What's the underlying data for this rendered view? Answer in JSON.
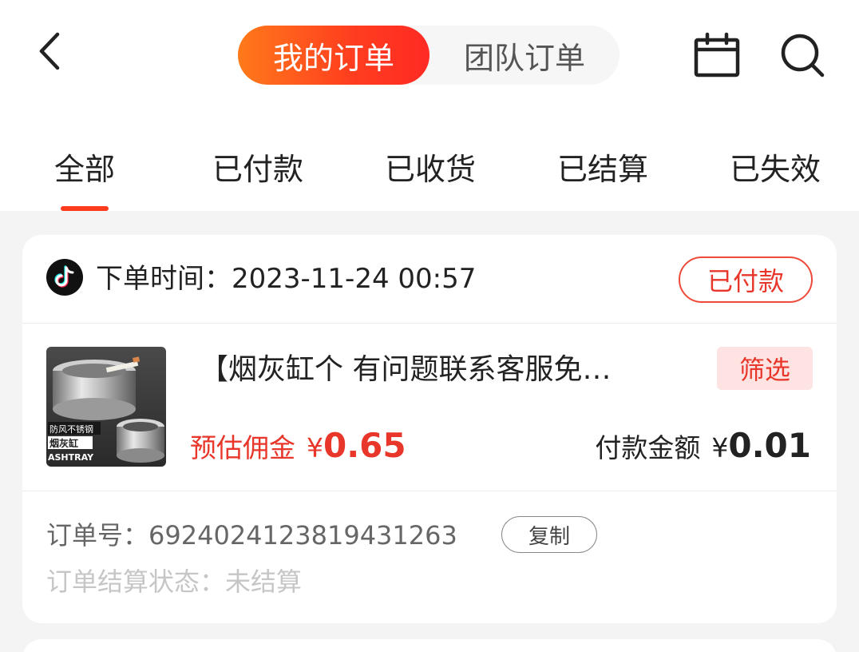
{
  "header": {
    "segments": [
      {
        "label": "我的订单",
        "active": true
      },
      {
        "label": "团队订单",
        "active": false
      }
    ],
    "icons": {
      "back": "chevron-left-icon",
      "calendar": "calendar-icon",
      "search": "search-icon"
    }
  },
  "tabs": [
    {
      "label": "全部",
      "active": true
    },
    {
      "label": "已付款",
      "active": false
    },
    {
      "label": "已收货",
      "active": false
    },
    {
      "label": "已结算",
      "active": false
    },
    {
      "label": "已失效",
      "active": false
    }
  ],
  "order": {
    "platform_icon": "tiktok-icon",
    "time_label": "下单时间：",
    "time_value": "2023-11-24 00:57",
    "status": "已付款",
    "product": {
      "title": "【烟灰缸个 有问题联系客服免…",
      "image_text": {
        "line1": "防风不锈钢",
        "line2": "烟灰缸",
        "line3": "ASHTRAY"
      }
    },
    "filter_tag": "筛选",
    "commission_label": "预估佣金",
    "commission_currency": "¥",
    "commission_value": "0.65",
    "paid_label": "付款金额",
    "paid_currency": "¥",
    "paid_value": "0.01",
    "order_no_label": "订单号：",
    "order_no": "6924024123819431263",
    "copy_label": "复制",
    "settle_label": "订单结算状态：",
    "settle_value": "未结算"
  },
  "colors": {
    "accent": "#ff3b1e",
    "accent_gradient_start": "#ff7a1a",
    "price_red": "#e8362a",
    "filter_bg": "#fde3e1",
    "page_bg": "#f4f4f4"
  }
}
